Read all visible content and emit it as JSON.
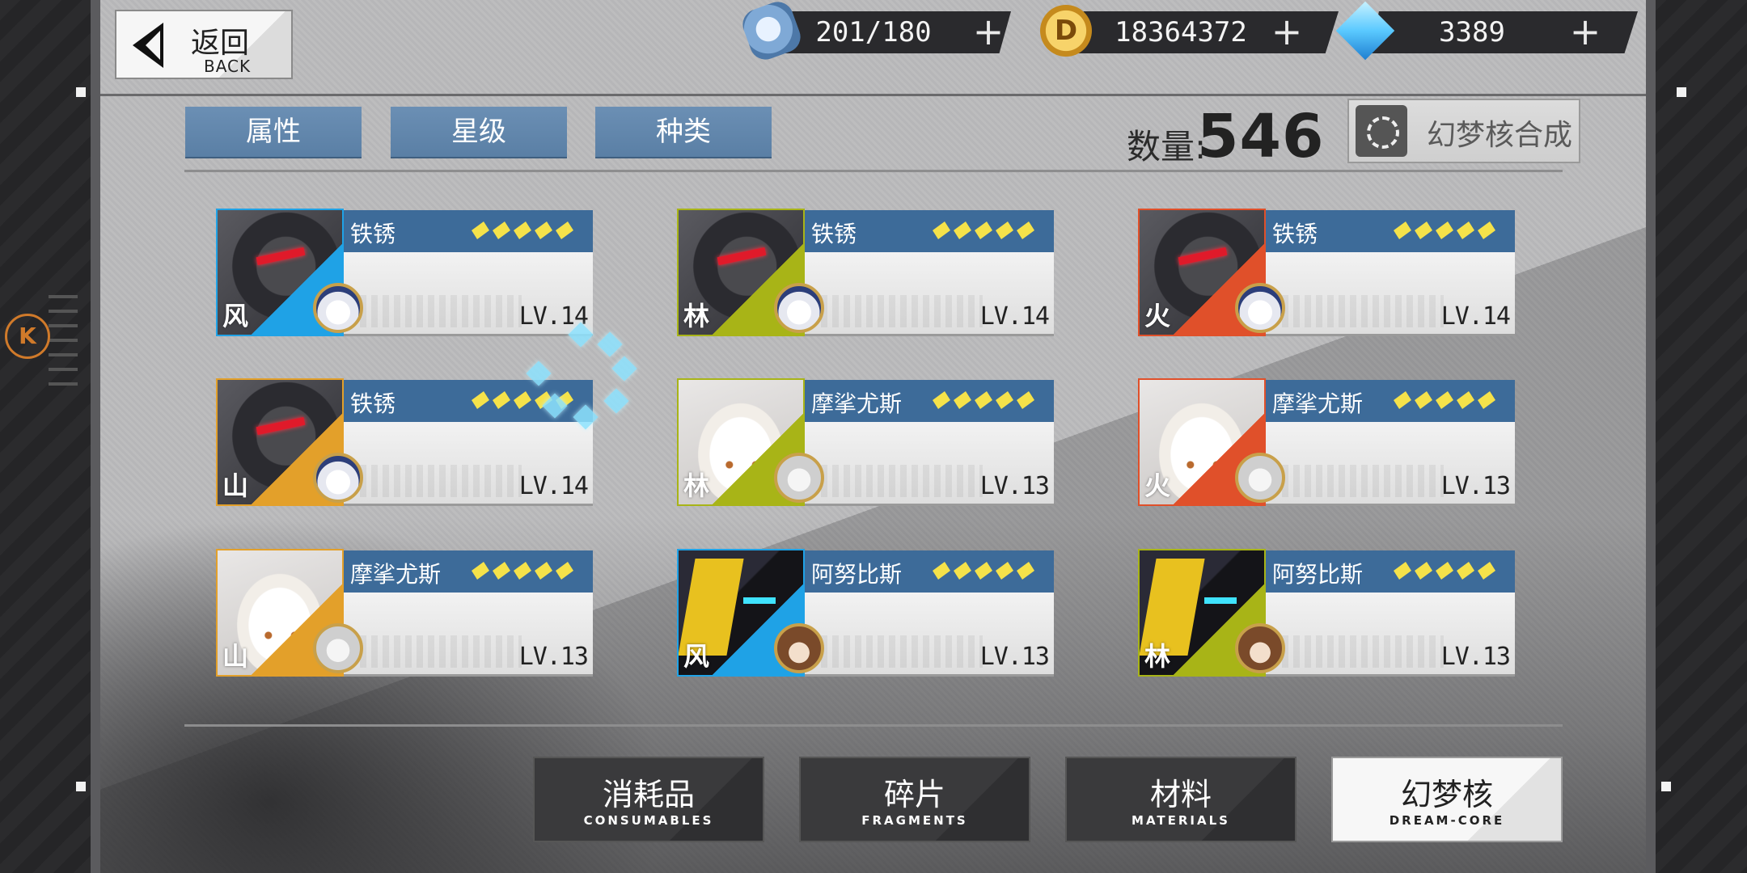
{
  "header": {
    "back": {
      "label_cn": "返回",
      "label_en": "BACK"
    },
    "currencies": [
      {
        "name": "stamina",
        "icon": "ticket-icon",
        "value": "201/180"
      },
      {
        "name": "coins",
        "icon": "coin-icon",
        "value": "18364372",
        "glyph": "D"
      },
      {
        "name": "crystals",
        "icon": "crystal-icon",
        "value": "3389"
      }
    ],
    "plus": "+"
  },
  "filters": [
    "属性",
    "星级",
    "种类"
  ],
  "count": {
    "label": "数量:",
    "value": "546"
  },
  "synth": {
    "label": "幻梦核合成"
  },
  "cards": [
    {
      "name": "铁锈",
      "element": "风",
      "element_color": "#1fa2e6",
      "level": "LV.14",
      "stars": 5,
      "portrait": "mech",
      "pilot": "white"
    },
    {
      "name": "铁锈",
      "element": "林",
      "element_color": "#a8b417",
      "level": "LV.14",
      "stars": 5,
      "portrait": "mech",
      "pilot": "white"
    },
    {
      "name": "铁锈",
      "element": "火",
      "element_color": "#e0502a",
      "level": "LV.14",
      "stars": 5,
      "portrait": "mech",
      "pilot": "white"
    },
    {
      "name": "铁锈",
      "element": "山",
      "element_color": "#e3a02a",
      "level": "LV.14",
      "stars": 5,
      "portrait": "mech",
      "pilot": "white"
    },
    {
      "name": "摩挲尤斯",
      "element": "林",
      "element_color": "#a8b417",
      "level": "LV.13",
      "stars": 5,
      "portrait": "girl",
      "pilot": "grey"
    },
    {
      "name": "摩挲尤斯",
      "element": "火",
      "element_color": "#e0502a",
      "level": "LV.13",
      "stars": 5,
      "portrait": "girl",
      "pilot": "grey"
    },
    {
      "name": "摩挲尤斯",
      "element": "山",
      "element_color": "#e3a02a",
      "level": "LV.13",
      "stars": 5,
      "portrait": "girl",
      "pilot": "grey"
    },
    {
      "name": "阿努比斯",
      "element": "风",
      "element_color": "#1fa2e6",
      "level": "LV.13",
      "stars": 5,
      "portrait": "jackal",
      "pilot": "brown"
    },
    {
      "name": "阿努比斯",
      "element": "林",
      "element_color": "#a8b417",
      "level": "LV.13",
      "stars": 5,
      "portrait": "jackal",
      "pilot": "brown"
    }
  ],
  "bottom_tabs": [
    {
      "cn": "消耗品",
      "en": "CONSUMABLES",
      "active": false
    },
    {
      "cn": "碎片",
      "en": "FRAGMENTS",
      "active": false
    },
    {
      "cn": "材料",
      "en": "MATERIALS",
      "active": false
    },
    {
      "cn": "幻梦核",
      "en": "DREAM-CORE",
      "active": true
    }
  ],
  "side_emblem": "K",
  "colors": {
    "header_blue": "#3d6b99",
    "star_yellow": "#f5e24a",
    "spinner": "#8ee3ff"
  }
}
